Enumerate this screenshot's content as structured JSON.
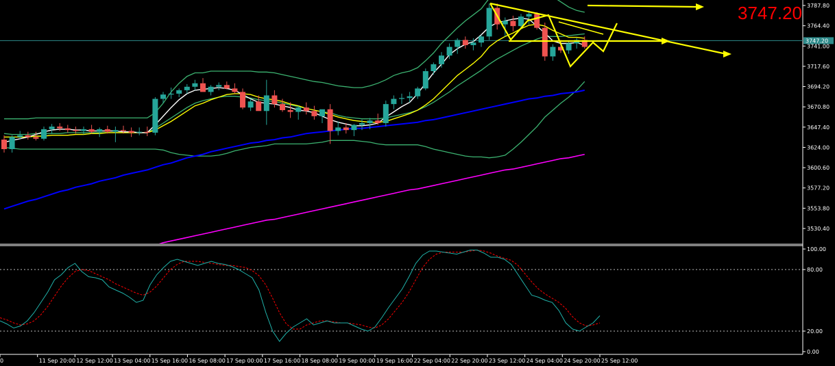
{
  "current_price_label": "3747.20",
  "colors": {
    "background": "#000000",
    "bull": "#26a69a",
    "bear": "#ef5350",
    "bollinger": "#3cb371",
    "ma_blue": "#0000ff",
    "ma_magenta": "#ff00ff",
    "ma_yellow": "#ffff00",
    "ma_white": "#ffffff",
    "stoch_main": "#20b2aa",
    "stoch_signal": "#ff0000",
    "annotation": "#ffff00",
    "price_line": "#2e8b8b"
  },
  "chart_data": [
    {
      "type": "candlestick",
      "title": "",
      "ylim": [
        3507,
        3798
      ],
      "y_ticks": [
        "3787.80",
        "3764.40",
        "3741.00",
        "3717.60",
        "3694.20",
        "3670.80",
        "3647.40",
        "3624.00",
        "3600.60",
        "3577.20",
        "3553.80",
        "3530.40"
      ],
      "x_tick_labels": [
        "0",
        "11 Sep 20:00",
        "12 Sep 12:00",
        "13 Sep 04:00",
        "15 Sep 16:00",
        "16 Sep 08:00",
        "17 Sep 00:00",
        "17 Sep 16:00",
        "18 Sep 08:00",
        "19 Sep 00:00",
        "19 Sep 16:00",
        "22 Sep 04:00",
        "22 Sep 20:00",
        "23 Sep 12:00",
        "24 Sep 04:00",
        "24 Sep 20:00",
        "25 Sep 12:00"
      ],
      "current_price": 3747.2,
      "candles": [
        [
          3633,
          3638,
          3618,
          3622
        ],
        [
          3622,
          3638,
          3618,
          3636
        ],
        [
          3636,
          3643,
          3633,
          3638
        ],
        [
          3638,
          3642,
          3633,
          3636
        ],
        [
          3636,
          3642,
          3632,
          3634
        ],
        [
          3634,
          3648,
          3632,
          3645
        ],
        [
          3645,
          3651,
          3640,
          3648
        ],
        [
          3648,
          3652,
          3643,
          3646
        ],
        [
          3646,
          3650,
          3641,
          3644
        ],
        [
          3644,
          3648,
          3640,
          3643
        ],
        [
          3643,
          3648,
          3639,
          3645
        ],
        [
          3645,
          3650,
          3640,
          3642
        ],
        [
          3642,
          3647,
          3636,
          3645
        ],
        [
          3645,
          3649,
          3640,
          3642
        ],
        [
          3642,
          3648,
          3630,
          3644
        ],
        [
          3644,
          3649,
          3640,
          3643
        ],
        [
          3643,
          3647,
          3636,
          3641
        ],
        [
          3641,
          3647,
          3638,
          3642
        ],
        [
          3642,
          3648,
          3637,
          3641
        ],
        [
          3641,
          3682,
          3638,
          3680
        ],
        [
          3680,
          3688,
          3675,
          3685
        ],
        [
          3685,
          3693,
          3680,
          3686
        ],
        [
          3686,
          3692,
          3682,
          3690
        ],
        [
          3690,
          3697,
          3686,
          3694
        ],
        [
          3694,
          3702,
          3690,
          3698
        ],
        [
          3698,
          3704,
          3693,
          3688
        ],
        [
          3688,
          3696,
          3684,
          3694
        ],
        [
          3694,
          3699,
          3690,
          3696
        ],
        [
          3696,
          3700,
          3691,
          3692
        ],
        [
          3692,
          3698,
          3686,
          3688
        ],
        [
          3688,
          3692,
          3668,
          3670
        ],
        [
          3670,
          3680,
          3666,
          3677
        ],
        [
          3677,
          3684,
          3672,
          3666
        ],
        [
          3666,
          3702,
          3650,
          3684
        ],
        [
          3684,
          3690,
          3670,
          3674
        ],
        [
          3674,
          3680,
          3665,
          3667
        ],
        [
          3667,
          3676,
          3658,
          3665
        ],
        [
          3665,
          3672,
          3656,
          3670
        ],
        [
          3670,
          3676,
          3662,
          3666
        ],
        [
          3666,
          3672,
          3656,
          3660
        ],
        [
          3660,
          3664,
          3652,
          3668
        ],
        [
          3668,
          3674,
          3628,
          3643
        ],
        [
          3643,
          3654,
          3638,
          3647
        ],
        [
          3647,
          3652,
          3640,
          3644
        ],
        [
          3644,
          3651,
          3637,
          3650
        ],
        [
          3650,
          3656,
          3644,
          3652
        ],
        [
          3652,
          3658,
          3645,
          3655
        ],
        [
          3655,
          3663,
          3650,
          3652
        ],
        [
          3652,
          3678,
          3648,
          3674
        ],
        [
          3674,
          3684,
          3668,
          3680
        ],
        [
          3680,
          3686,
          3674,
          3681
        ],
        [
          3681,
          3688,
          3676,
          3683
        ],
        [
          3683,
          3694,
          3680,
          3692
        ],
        [
          3692,
          3715,
          3690,
          3712
        ],
        [
          3712,
          3722,
          3708,
          3720
        ],
        [
          3720,
          3734,
          3716,
          3730
        ],
        [
          3730,
          3744,
          3726,
          3740
        ],
        [
          3740,
          3750,
          3732,
          3748
        ],
        [
          3748,
          3752,
          3738,
          3742
        ],
        [
          3742,
          3750,
          3736,
          3745
        ],
        [
          3745,
          3754,
          3740,
          3752
        ],
        [
          3752,
          3790,
          3748,
          3785
        ],
        [
          3785,
          3790,
          3760,
          3766
        ],
        [
          3766,
          3774,
          3752,
          3770
        ],
        [
          3770,
          3776,
          3758,
          3764
        ],
        [
          3764,
          3778,
          3760,
          3775
        ],
        [
          3775,
          3782,
          3766,
          3778
        ],
        [
          3778,
          3780,
          3760,
          3762
        ],
        [
          3762,
          3768,
          3724,
          3729
        ],
        [
          3729,
          3743,
          3724,
          3740
        ],
        [
          3740,
          3748,
          3733,
          3736
        ],
        [
          3736,
          3746,
          3732,
          3744
        ],
        [
          3744,
          3750,
          3738,
          3748
        ],
        [
          3748,
          3752,
          3738,
          3740
        ]
      ],
      "bb_upper": [
        3657,
        3657,
        3657,
        3657,
        3658,
        3658,
        3658,
        3658,
        3658,
        3658,
        3658,
        3658,
        3658,
        3658,
        3658,
        3658,
        3658,
        3658,
        3658,
        3664,
        3675,
        3688,
        3698,
        3706,
        3710,
        3710,
        3712,
        3712,
        3712,
        3712,
        3712,
        3712,
        3711,
        3711,
        3710,
        3708,
        3706,
        3704,
        3702,
        3700,
        3699,
        3697,
        3695,
        3694,
        3693,
        3693,
        3695,
        3698,
        3702,
        3707,
        3710,
        3712,
        3716,
        3724,
        3733,
        3744,
        3753,
        3762,
        3770,
        3777,
        3784,
        3796,
        3805,
        3810,
        3812,
        3810,
        3808,
        3806,
        3804,
        3798,
        3792,
        3786,
        3782,
        3780
      ],
      "bb_middle": [
        3640,
        3639,
        3639,
        3639,
        3640,
        3640,
        3640,
        3640,
        3641,
        3641,
        3641,
        3641,
        3641,
        3641,
        3641,
        3641,
        3641,
        3641,
        3641,
        3646,
        3652,
        3658,
        3664,
        3670,
        3675,
        3678,
        3680,
        3682,
        3683,
        3683,
        3682,
        3681,
        3679,
        3678,
        3677,
        3675,
        3673,
        3671,
        3669,
        3667,
        3665,
        3664,
        3661,
        3659,
        3658,
        3657,
        3657,
        3657,
        3658,
        3660,
        3662,
        3664,
        3667,
        3671,
        3676,
        3682,
        3688,
        3695,
        3701,
        3707,
        3713,
        3720,
        3726,
        3731,
        3736,
        3741,
        3745,
        3749,
        3752,
        3752,
        3752,
        3753,
        3754,
        3755
      ],
      "bb_lower": [
        3624,
        3623,
        3622,
        3622,
        3622,
        3622,
        3622,
        3622,
        3622,
        3622,
        3622,
        3622,
        3622,
        3622,
        3622,
        3622,
        3622,
        3622,
        3622,
        3622,
        3621,
        3618,
        3616,
        3615,
        3614,
        3614,
        3614,
        3615,
        3617,
        3620,
        3622,
        3624,
        3625,
        3626,
        3628,
        3628,
        3628,
        3628,
        3628,
        3629,
        3630,
        3632,
        3632,
        3632,
        3632,
        3631,
        3630,
        3628,
        3627,
        3627,
        3627,
        3627,
        3627,
        3625,
        3622,
        3620,
        3618,
        3616,
        3614,
        3613,
        3613,
        3612,
        3613,
        3615,
        3622,
        3630,
        3639,
        3648,
        3659,
        3667,
        3675,
        3682,
        3690,
        3700
      ],
      "ma_blue": [
        3553,
        3556,
        3559,
        3562,
        3564,
        3567,
        3570,
        3573,
        3575,
        3578,
        3580,
        3582,
        3585,
        3587,
        3589,
        3592,
        3594,
        3596,
        3598,
        3601,
        3604,
        3606,
        3609,
        3612,
        3614,
        3616,
        3619,
        3621,
        3623,
        3625,
        3627,
        3629,
        3630,
        3632,
        3633,
        3635,
        3636,
        3638,
        3640,
        3641,
        3642,
        3643,
        3644,
        3645,
        3646,
        3646,
        3647,
        3648,
        3649,
        3650,
        3651,
        3652,
        3653,
        3655,
        3656,
        3658,
        3660,
        3662,
        3664,
        3666,
        3668,
        3670,
        3672,
        3674,
        3676,
        3678,
        3680,
        3681,
        3683,
        3684,
        3686,
        3687,
        3688,
        3690
      ],
      "ma_magenta": [
        3507,
        3509,
        3511,
        3514,
        3516,
        3518,
        3520,
        3522,
        3524,
        3526,
        3528,
        3530,
        3532,
        3534,
        3536,
        3538,
        3540,
        3541,
        3543,
        3545,
        3547,
        3549,
        3551,
        3553,
        3555,
        3557,
        3559,
        3561,
        3563,
        3565,
        3567,
        3569,
        3571,
        3573,
        3575,
        3576,
        3578,
        3580,
        3582,
        3584,
        3586,
        3588,
        3590,
        3592,
        3594,
        3596,
        3598,
        3599,
        3601,
        3603,
        3605,
        3607,
        3609,
        3611,
        3612,
        3614,
        3616
      ],
      "ma_yellow": [
        3636,
        3636,
        3636,
        3636,
        3637,
        3637,
        3638,
        3638,
        3638,
        3639,
        3639,
        3640,
        3640,
        3641,
        3641,
        3641,
        3641,
        3641,
        3641,
        3644,
        3649,
        3654,
        3660,
        3666,
        3672,
        3675,
        3679,
        3682,
        3685,
        3686,
        3686,
        3685,
        3682,
        3680,
        3679,
        3677,
        3674,
        3672,
        3669,
        3667,
        3665,
        3662,
        3659,
        3657,
        3655,
        3654,
        3653,
        3653,
        3654,
        3657,
        3660,
        3663,
        3667,
        3673,
        3680,
        3689,
        3698,
        3707,
        3714,
        3721,
        3729,
        3740,
        3747,
        3752,
        3756,
        3761,
        3765,
        3766,
        3764,
        3759,
        3755,
        3751,
        3751,
        3750
      ],
      "ma_white": [
        3630,
        3632,
        3634,
        3636,
        3639,
        3642,
        3644,
        3645,
        3645,
        3644,
        3644,
        3643,
        3643,
        3643,
        3643,
        3642,
        3642,
        3641,
        3641,
        3650,
        3660,
        3670,
        3679,
        3686,
        3690,
        3691,
        3692,
        3693,
        3692,
        3690,
        3685,
        3680,
        3676,
        3675,
        3674,
        3672,
        3670,
        3667,
        3666,
        3664,
        3660,
        3656,
        3653,
        3651,
        3649,
        3649,
        3650,
        3652,
        3659,
        3665,
        3671,
        3676,
        3686,
        3698,
        3710,
        3720,
        3731,
        3738,
        3743,
        3746,
        3754,
        3763,
        3768,
        3770,
        3772,
        3773,
        3772,
        3764,
        3756,
        3747,
        3744,
        3744,
        3745,
        3742
      ]
    },
    {
      "type": "line",
      "title": "",
      "ylim": [
        0,
        100
      ],
      "y_ticks": [
        "100.00",
        "80.00",
        "20.00",
        "0.00"
      ],
      "levels": [
        80,
        20
      ],
      "series": [
        {
          "values": [
            30,
            27,
            23,
            25,
            30,
            38,
            48,
            58,
            70,
            75,
            82,
            86,
            78,
            73,
            72,
            70,
            63,
            60,
            57,
            53,
            48,
            50,
            65,
            75,
            82,
            88,
            90,
            88,
            86,
            84,
            86,
            88,
            86,
            85,
            83,
            80,
            76,
            72,
            60,
            38,
            20,
            10,
            18,
            24,
            28,
            32,
            26,
            28,
            30,
            28,
            28,
            28,
            25,
            22,
            20,
            24,
            33,
            43,
            52,
            61,
            73,
            86,
            94,
            98,
            98,
            97,
            96,
            95,
            97,
            99,
            99,
            96,
            92,
            92,
            90,
            85,
            75,
            65,
            55,
            53,
            50,
            48,
            40,
            28,
            22,
            20,
            24,
            28,
            35
          ]
        },
        {
          "values": [
            33,
            31,
            28,
            26,
            27,
            30,
            36,
            44,
            54,
            64,
            72,
            78,
            80,
            79,
            76,
            73,
            70,
            66,
            63,
            60,
            57,
            55,
            58,
            64,
            72,
            80,
            85,
            88,
            88,
            88,
            87,
            86,
            85,
            84,
            84,
            83,
            82,
            79,
            74,
            65,
            52,
            38,
            27,
            22,
            22,
            26,
            28,
            30,
            30,
            29,
            28,
            28,
            27,
            26,
            24,
            23,
            26,
            32,
            40,
            48,
            58,
            70,
            82,
            90,
            95,
            97,
            97,
            97,
            97,
            98,
            99,
            98,
            96,
            93,
            91,
            89,
            84,
            76,
            68,
            61,
            56,
            52,
            48,
            42,
            34,
            28,
            25,
            26,
            28
          ]
        }
      ]
    }
  ]
}
